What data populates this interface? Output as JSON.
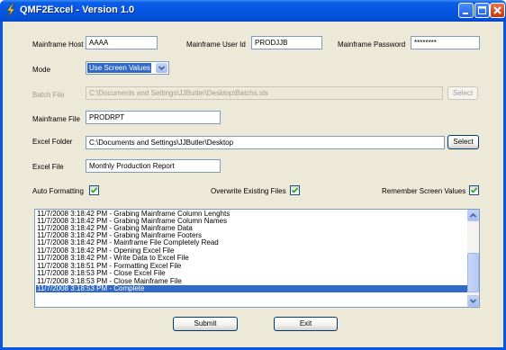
{
  "window": {
    "title": "QMF2Excel - Version 1.0"
  },
  "labels": {
    "mainframe_host": "Mainframe Host",
    "mainframe_user_id": "Mainframe User Id",
    "mainframe_password": "Mainframe Password",
    "mode": "Mode",
    "batch_file": "Batch File",
    "mainframe_file": "Mainframe File",
    "excel_folder": "Excel Folder",
    "excel_file": "Excel File",
    "auto_formatting": "Auto Formatting",
    "overwrite_existing_files": "Overwrite Existing Files",
    "remember_screen_values": "Remember Screen Values"
  },
  "fields": {
    "mainframe_host": "AAAA",
    "mainframe_user_id": "PRODJJB",
    "mainframe_password": "********",
    "mode": "Use Screen Values",
    "batch_file": "C:\\Documents and Settings\\JJButler\\Desktop\\Batchs.xls",
    "mainframe_file": "PRODRPT",
    "excel_folder": "C:\\Documents and Settings\\JJButler\\Desktop",
    "excel_file": "Monthly Production Report"
  },
  "checkboxes": {
    "auto_formatting": true,
    "overwrite_existing_files": true,
    "remember_screen_values": true
  },
  "buttons": {
    "select_batch": "Select",
    "select_folder": "Select",
    "submit": "Submit",
    "exit": "Exit"
  },
  "log": [
    "11/7/2008 3:18:42 PM - Grabing Mainframe Column Lenghts",
    "11/7/2008 3:18:42 PM - Grabing Mainframe Column Names",
    "11/7/2008 3:18:42 PM - Grabing Mainframe Data",
    "11/7/2008 3:18:42 PM - Grabing Mainframe Footers",
    "11/7/2008 3:18:42 PM - Mainframe File Completely Read",
    "11/7/2008 3:18:42 PM - Opening Excel File",
    "11/7/2008 3:18:42 PM - Write Data to Excel File",
    "11/7/2008 3:18:51 PM - Formatting Excel File",
    "11/7/2008 3:18:53 PM - Close Excel File",
    "11/7/2008 3:18:53 PM - Close Mainframe File",
    "11/7/2008 3:18:53 PM - Complete"
  ],
  "icons": {
    "app": "lightning-icon",
    "minimize": "minimize-icon",
    "maximize": "maximize-icon",
    "close": "close-icon",
    "dropdown": "chevron-down-icon",
    "check": "check-icon",
    "scroll_up": "scroll-up-icon",
    "scroll_down": "scroll-down-icon"
  }
}
